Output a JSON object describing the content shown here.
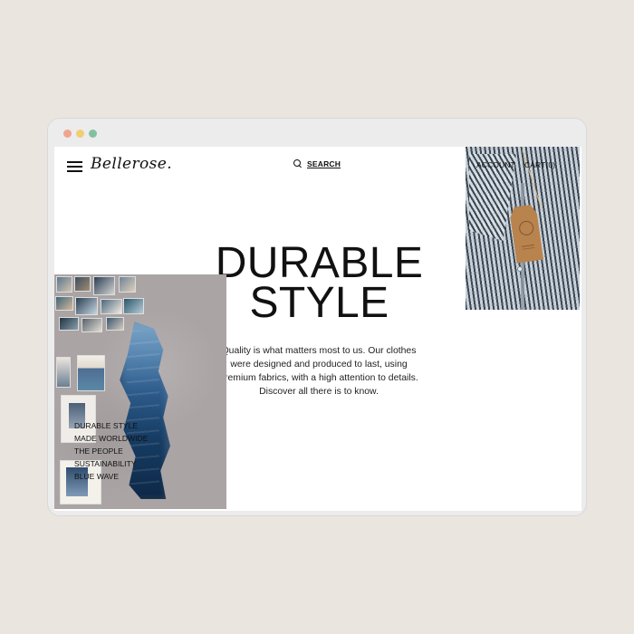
{
  "brand": {
    "logo_text": "Bellerose."
  },
  "header": {
    "search_label": "SEARCH",
    "account_label": "ACCOUNT",
    "cart_label": "CART(0)"
  },
  "hero": {
    "title_line1": "DURABLE",
    "title_line2": "STYLE",
    "copy_line1": "Quality is what matters most to us. Our clothes",
    "copy_line2": "were designed and produced to last, using",
    "copy_line3": "premium fabrics, with a high attention to details.",
    "copy_line4": "Discover all there is to know."
  },
  "collage_menu": {
    "items": [
      "DURABLE STYLE",
      "MADE WORLDWIDE",
      "THE PEOPLE",
      "SUSTAINABILITY",
      "BLUE WAVE"
    ]
  },
  "icons": {
    "menu": "hamburger-menu-icon",
    "search": "search-icon"
  },
  "colors": {
    "background": "#ebe5df",
    "window_chrome": "#ececec",
    "close_dot": "#f0a48d",
    "minimize_dot": "#f3cd72",
    "zoom_dot": "#82c1a0",
    "text": "#111111"
  }
}
